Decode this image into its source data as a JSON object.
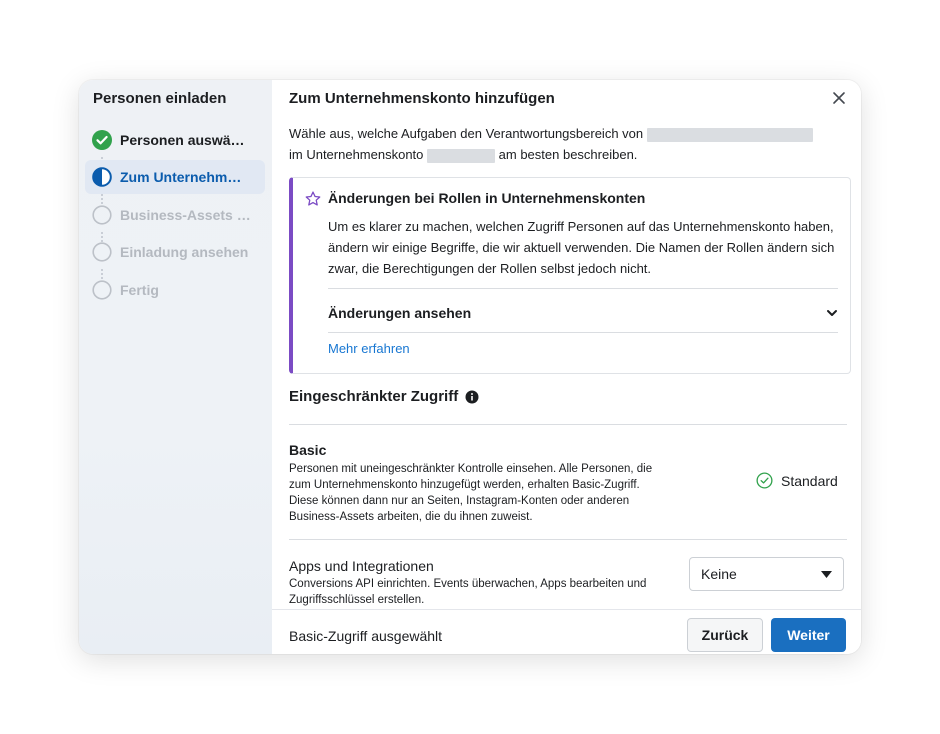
{
  "sidebar": {
    "title": "Personen einladen",
    "steps": [
      {
        "label": "Personen auswä…",
        "state": "done"
      },
      {
        "label": "Zum Unternehm…",
        "state": "active"
      },
      {
        "label": "Business-Assets …",
        "state": "todo"
      },
      {
        "label": "Einladung ansehen",
        "state": "todo"
      },
      {
        "label": "Fertig",
        "state": "todo"
      }
    ]
  },
  "header": {
    "title": "Zum Unternehmenskonto hinzufügen"
  },
  "intro": {
    "part1": "Wähle aus, welche Aufgaben den Verantwortungsbereich von",
    "part2": "im Unternehmenskonto",
    "part3": "am besten beschreiben."
  },
  "notice": {
    "title": "Änderungen bei Rollen in Unternehmenskonten",
    "body": "Um es klarer zu machen, welchen Zugriff Personen auf das Unternehmenskonto haben, ändern wir einige Begriffe, die wir aktuell verwenden. Die Namen der Rollen ändern sich zwar, die Berechtigungen der Rollen selbst jedoch nicht.",
    "toggle_label": "Änderungen ansehen",
    "link_label": "Mehr erfahren"
  },
  "restricted": {
    "title": "Eingeschränkter Zugriff",
    "basic": {
      "name": "Basic",
      "description": "Personen mit uneingeschränkter Kontrolle einsehen. Alle Personen, die zum Unternehmenskonto hinzugefügt werden, erhalten Basic-Zugriff. Diese können dann nur an Seiten, Instagram-Konten oder anderen Business-Assets arbeiten, die du ihnen zuweist.",
      "status": "Standard"
    },
    "apps": {
      "name": "Apps und Integrationen",
      "description": "Conversions API einrichten. Events überwachen, Apps bearbeiten und Zugriffsschlüssel erstellen.",
      "selected": "Keine"
    }
  },
  "footer": {
    "status": "Basic-Zugriff ausgewählt",
    "back_label": "Zurück",
    "next_label": "Weiter"
  },
  "colors": {
    "accent": "#1a6fc0",
    "done_green": "#31a24c",
    "notice_border": "#7b4bc4",
    "link": "#1877d2"
  }
}
